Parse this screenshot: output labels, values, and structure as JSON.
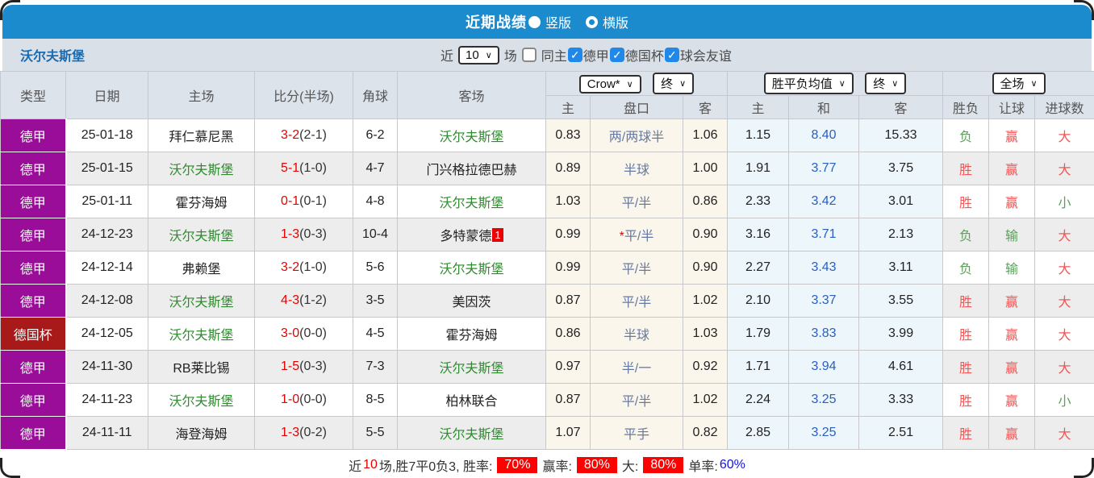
{
  "colors": {
    "accent_blue": "#1b8bce",
    "league_purple": "#990d99",
    "league_darkred": "#a81a1a",
    "score_red": "#e80000",
    "self_green": "#2e8b2e",
    "avg_draw_blue": "#2a5fc0"
  },
  "titlebar": {
    "title": "近期战绩",
    "radio_vertical": "竖版",
    "radio_horizontal": "横版"
  },
  "controls": {
    "team": "沃尔夫斯堡",
    "near_label": "近",
    "games_value": "10",
    "games_label": "场",
    "same_home_label": "同主",
    "filters": [
      {
        "label": "德甲"
      },
      {
        "label": "德国杯"
      },
      {
        "label": "球会友谊"
      }
    ]
  },
  "header": {
    "col_type": "类型",
    "col_date": "日期",
    "col_home": "主场",
    "col_score": "比分(半场)",
    "col_corner": "角球",
    "col_away": "客场",
    "dd_provider": "Crow*",
    "dd_final1": "终",
    "dd_avg": "胜平负均值",
    "dd_final2": "终",
    "dd_scope": "全场",
    "sub": [
      "主",
      "盘口",
      "客",
      "主",
      "和",
      "客",
      "胜负",
      "让球",
      "进球数"
    ]
  },
  "table": {
    "rows": [
      {
        "league": "德甲",
        "league_color": "purple",
        "date": "25-01-18",
        "home": "拜仁慕尼黑",
        "home_c": "",
        "score": "3-2",
        "half": "(2-1)",
        "corner": "6-2",
        "away": "沃尔夫斯堡",
        "away_c": "self",
        "away_badge": "",
        "odds_home": "0.83",
        "handicap_star": "",
        "handicap": "两/两球半",
        "odds_away": "1.06",
        "avg_home": "1.15",
        "avg_draw": "8.40",
        "avg_away": "15.33",
        "wl": "负",
        "wl_c": "green",
        "hc": "赢",
        "hc_c": "red",
        "goals": "大",
        "goals_c": "red"
      },
      {
        "league": "德甲",
        "league_color": "purple",
        "date": "25-01-15",
        "home": "沃尔夫斯堡",
        "home_c": "self",
        "score": "5-1",
        "half": "(1-0)",
        "corner": "4-7",
        "away": "门兴格拉德巴赫",
        "away_c": "",
        "away_badge": "",
        "odds_home": "0.89",
        "handicap_star": "",
        "handicap": "半球",
        "odds_away": "1.00",
        "avg_home": "1.91",
        "avg_draw": "3.77",
        "avg_away": "3.75",
        "wl": "胜",
        "wl_c": "red",
        "hc": "赢",
        "hc_c": "red",
        "goals": "大",
        "goals_c": "red"
      },
      {
        "league": "德甲",
        "league_color": "purple",
        "date": "25-01-11",
        "home": "霍芬海姆",
        "home_c": "",
        "score": "0-1",
        "half": "(0-1)",
        "corner": "4-8",
        "away": "沃尔夫斯堡",
        "away_c": "self",
        "away_badge": "",
        "odds_home": "1.03",
        "handicap_star": "",
        "handicap": "平/半",
        "odds_away": "0.86",
        "avg_home": "2.33",
        "avg_draw": "3.42",
        "avg_away": "3.01",
        "wl": "胜",
        "wl_c": "red",
        "hc": "赢",
        "hc_c": "red",
        "goals": "小",
        "goals_c": "green"
      },
      {
        "league": "德甲",
        "league_color": "purple",
        "date": "24-12-23",
        "home": "沃尔夫斯堡",
        "home_c": "self",
        "score": "1-3",
        "half": "(0-3)",
        "corner": "10-4",
        "away": "多特蒙德",
        "away_c": "",
        "away_badge": "1",
        "odds_home": "0.99",
        "handicap_star": "*",
        "handicap": "平/半",
        "odds_away": "0.90",
        "avg_home": "3.16",
        "avg_draw": "3.71",
        "avg_away": "2.13",
        "wl": "负",
        "wl_c": "green",
        "hc": "输",
        "hc_c": "green",
        "goals": "大",
        "goals_c": "red"
      },
      {
        "league": "德甲",
        "league_color": "purple",
        "date": "24-12-14",
        "home": "弗赖堡",
        "home_c": "",
        "score": "3-2",
        "half": "(1-0)",
        "corner": "5-6",
        "away": "沃尔夫斯堡",
        "away_c": "self",
        "away_badge": "",
        "odds_home": "0.99",
        "handicap_star": "",
        "handicap": "平/半",
        "odds_away": "0.90",
        "avg_home": "2.27",
        "avg_draw": "3.43",
        "avg_away": "3.11",
        "wl": "负",
        "wl_c": "green",
        "hc": "输",
        "hc_c": "green",
        "goals": "大",
        "goals_c": "red"
      },
      {
        "league": "德甲",
        "league_color": "purple",
        "date": "24-12-08",
        "home": "沃尔夫斯堡",
        "home_c": "self",
        "score": "4-3",
        "half": "(1-2)",
        "corner": "3-5",
        "away": "美因茨",
        "away_c": "",
        "away_badge": "",
        "odds_home": "0.87",
        "handicap_star": "",
        "handicap": "平/半",
        "odds_away": "1.02",
        "avg_home": "2.10",
        "avg_draw": "3.37",
        "avg_away": "3.55",
        "wl": "胜",
        "wl_c": "red",
        "hc": "赢",
        "hc_c": "red",
        "goals": "大",
        "goals_c": "red"
      },
      {
        "league": "德国杯",
        "league_color": "darkred",
        "date": "24-12-05",
        "home": "沃尔夫斯堡",
        "home_c": "self",
        "score": "3-0",
        "half": "(0-0)",
        "corner": "4-5",
        "away": "霍芬海姆",
        "away_c": "",
        "away_badge": "",
        "odds_home": "0.86",
        "handicap_star": "",
        "handicap": "半球",
        "odds_away": "1.03",
        "avg_home": "1.79",
        "avg_draw": "3.83",
        "avg_away": "3.99",
        "wl": "胜",
        "wl_c": "red",
        "hc": "赢",
        "hc_c": "red",
        "goals": "大",
        "goals_c": "red"
      },
      {
        "league": "德甲",
        "league_color": "purple",
        "date": "24-11-30",
        "home": "RB莱比锡",
        "home_c": "",
        "score": "1-5",
        "half": "(0-3)",
        "corner": "7-3",
        "away": "沃尔夫斯堡",
        "away_c": "self",
        "away_badge": "",
        "odds_home": "0.97",
        "handicap_star": "",
        "handicap": "半/一",
        "odds_away": "0.92",
        "avg_home": "1.71",
        "avg_draw": "3.94",
        "avg_away": "4.61",
        "wl": "胜",
        "wl_c": "red",
        "hc": "赢",
        "hc_c": "red",
        "goals": "大",
        "goals_c": "red"
      },
      {
        "league": "德甲",
        "league_color": "purple",
        "date": "24-11-23",
        "home": "沃尔夫斯堡",
        "home_c": "self",
        "score": "1-0",
        "half": "(0-0)",
        "corner": "8-5",
        "away": "柏林联合",
        "away_c": "",
        "away_badge": "",
        "odds_home": "0.87",
        "handicap_star": "",
        "handicap": "平/半",
        "odds_away": "1.02",
        "avg_home": "2.24",
        "avg_draw": "3.25",
        "avg_away": "3.33",
        "wl": "胜",
        "wl_c": "red",
        "hc": "赢",
        "hc_c": "red",
        "goals": "小",
        "goals_c": "green"
      },
      {
        "league": "德甲",
        "league_color": "purple",
        "date": "24-11-11",
        "home": "海登海姆",
        "home_c": "",
        "score": "1-3",
        "half": "(0-2)",
        "corner": "5-5",
        "away": "沃尔夫斯堡",
        "away_c": "self",
        "away_badge": "",
        "odds_home": "1.07",
        "handicap_star": "",
        "handicap": "平手",
        "odds_away": "0.82",
        "avg_home": "2.85",
        "avg_draw": "3.25",
        "avg_away": "2.51",
        "wl": "胜",
        "wl_c": "red",
        "hc": "赢",
        "hc_c": "red",
        "goals": "大",
        "goals_c": "red"
      }
    ]
  },
  "footer": {
    "near": "近",
    "count": "10",
    "seg1": "场,胜7平0负3, 胜率:",
    "box1": "70%",
    "seg2": "赢率:",
    "box2": "80%",
    "seg3": "大:",
    "box3": "80%",
    "seg4": "单率:",
    "pct": "60%"
  }
}
